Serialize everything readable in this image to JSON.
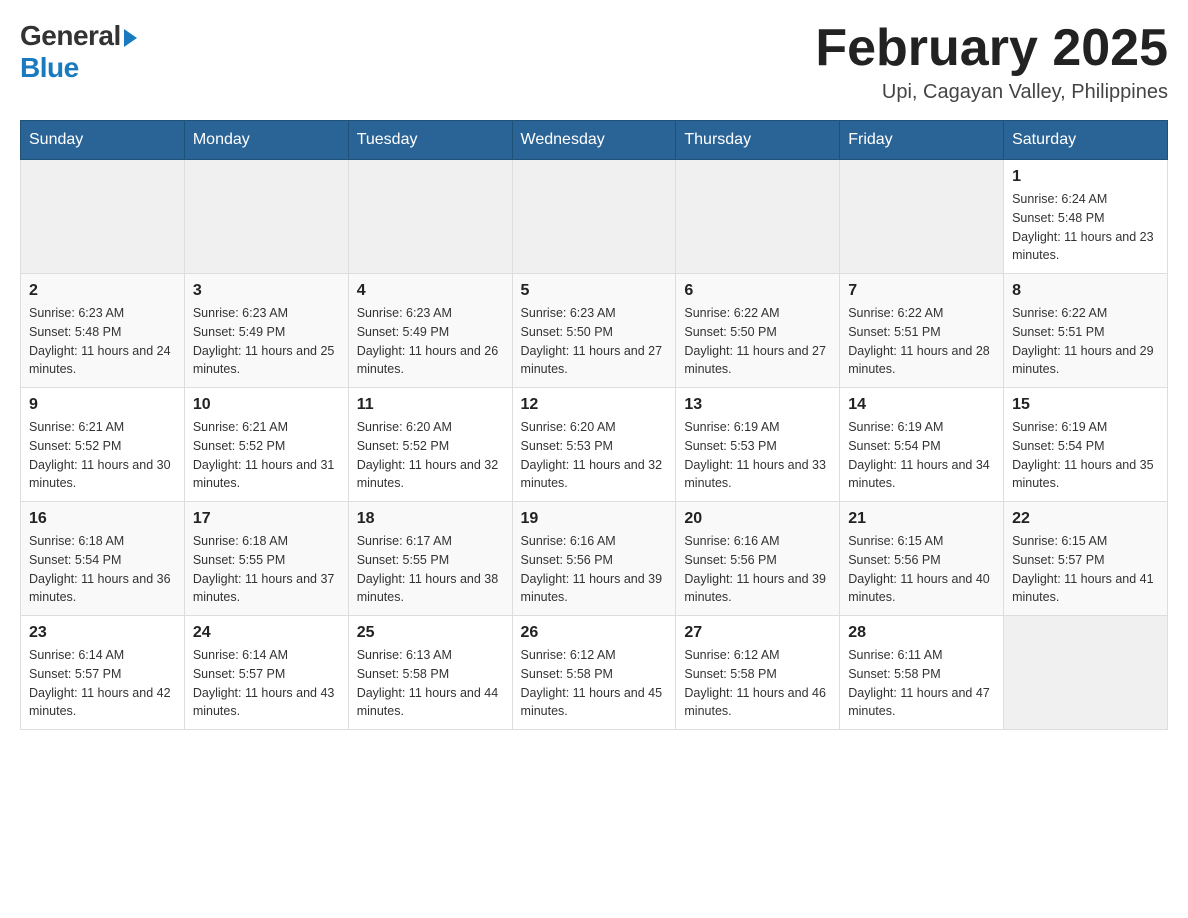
{
  "header": {
    "month_title": "February 2025",
    "location": "Upi, Cagayan Valley, Philippines",
    "logo_general": "General",
    "logo_blue": "Blue"
  },
  "weekdays": [
    "Sunday",
    "Monday",
    "Tuesday",
    "Wednesday",
    "Thursday",
    "Friday",
    "Saturday"
  ],
  "weeks": [
    [
      {
        "day": "",
        "sunrise": "",
        "sunset": "",
        "daylight": ""
      },
      {
        "day": "",
        "sunrise": "",
        "sunset": "",
        "daylight": ""
      },
      {
        "day": "",
        "sunrise": "",
        "sunset": "",
        "daylight": ""
      },
      {
        "day": "",
        "sunrise": "",
        "sunset": "",
        "daylight": ""
      },
      {
        "day": "",
        "sunrise": "",
        "sunset": "",
        "daylight": ""
      },
      {
        "day": "",
        "sunrise": "",
        "sunset": "",
        "daylight": ""
      },
      {
        "day": "1",
        "sunrise": "Sunrise: 6:24 AM",
        "sunset": "Sunset: 5:48 PM",
        "daylight": "Daylight: 11 hours and 23 minutes."
      }
    ],
    [
      {
        "day": "2",
        "sunrise": "Sunrise: 6:23 AM",
        "sunset": "Sunset: 5:48 PM",
        "daylight": "Daylight: 11 hours and 24 minutes."
      },
      {
        "day": "3",
        "sunrise": "Sunrise: 6:23 AM",
        "sunset": "Sunset: 5:49 PM",
        "daylight": "Daylight: 11 hours and 25 minutes."
      },
      {
        "day": "4",
        "sunrise": "Sunrise: 6:23 AM",
        "sunset": "Sunset: 5:49 PM",
        "daylight": "Daylight: 11 hours and 26 minutes."
      },
      {
        "day": "5",
        "sunrise": "Sunrise: 6:23 AM",
        "sunset": "Sunset: 5:50 PM",
        "daylight": "Daylight: 11 hours and 27 minutes."
      },
      {
        "day": "6",
        "sunrise": "Sunrise: 6:22 AM",
        "sunset": "Sunset: 5:50 PM",
        "daylight": "Daylight: 11 hours and 27 minutes."
      },
      {
        "day": "7",
        "sunrise": "Sunrise: 6:22 AM",
        "sunset": "Sunset: 5:51 PM",
        "daylight": "Daylight: 11 hours and 28 minutes."
      },
      {
        "day": "8",
        "sunrise": "Sunrise: 6:22 AM",
        "sunset": "Sunset: 5:51 PM",
        "daylight": "Daylight: 11 hours and 29 minutes."
      }
    ],
    [
      {
        "day": "9",
        "sunrise": "Sunrise: 6:21 AM",
        "sunset": "Sunset: 5:52 PM",
        "daylight": "Daylight: 11 hours and 30 minutes."
      },
      {
        "day": "10",
        "sunrise": "Sunrise: 6:21 AM",
        "sunset": "Sunset: 5:52 PM",
        "daylight": "Daylight: 11 hours and 31 minutes."
      },
      {
        "day": "11",
        "sunrise": "Sunrise: 6:20 AM",
        "sunset": "Sunset: 5:52 PM",
        "daylight": "Daylight: 11 hours and 32 minutes."
      },
      {
        "day": "12",
        "sunrise": "Sunrise: 6:20 AM",
        "sunset": "Sunset: 5:53 PM",
        "daylight": "Daylight: 11 hours and 32 minutes."
      },
      {
        "day": "13",
        "sunrise": "Sunrise: 6:19 AM",
        "sunset": "Sunset: 5:53 PM",
        "daylight": "Daylight: 11 hours and 33 minutes."
      },
      {
        "day": "14",
        "sunrise": "Sunrise: 6:19 AM",
        "sunset": "Sunset: 5:54 PM",
        "daylight": "Daylight: 11 hours and 34 minutes."
      },
      {
        "day": "15",
        "sunrise": "Sunrise: 6:19 AM",
        "sunset": "Sunset: 5:54 PM",
        "daylight": "Daylight: 11 hours and 35 minutes."
      }
    ],
    [
      {
        "day": "16",
        "sunrise": "Sunrise: 6:18 AM",
        "sunset": "Sunset: 5:54 PM",
        "daylight": "Daylight: 11 hours and 36 minutes."
      },
      {
        "day": "17",
        "sunrise": "Sunrise: 6:18 AM",
        "sunset": "Sunset: 5:55 PM",
        "daylight": "Daylight: 11 hours and 37 minutes."
      },
      {
        "day": "18",
        "sunrise": "Sunrise: 6:17 AM",
        "sunset": "Sunset: 5:55 PM",
        "daylight": "Daylight: 11 hours and 38 minutes."
      },
      {
        "day": "19",
        "sunrise": "Sunrise: 6:16 AM",
        "sunset": "Sunset: 5:56 PM",
        "daylight": "Daylight: 11 hours and 39 minutes."
      },
      {
        "day": "20",
        "sunrise": "Sunrise: 6:16 AM",
        "sunset": "Sunset: 5:56 PM",
        "daylight": "Daylight: 11 hours and 39 minutes."
      },
      {
        "day": "21",
        "sunrise": "Sunrise: 6:15 AM",
        "sunset": "Sunset: 5:56 PM",
        "daylight": "Daylight: 11 hours and 40 minutes."
      },
      {
        "day": "22",
        "sunrise": "Sunrise: 6:15 AM",
        "sunset": "Sunset: 5:57 PM",
        "daylight": "Daylight: 11 hours and 41 minutes."
      }
    ],
    [
      {
        "day": "23",
        "sunrise": "Sunrise: 6:14 AM",
        "sunset": "Sunset: 5:57 PM",
        "daylight": "Daylight: 11 hours and 42 minutes."
      },
      {
        "day": "24",
        "sunrise": "Sunrise: 6:14 AM",
        "sunset": "Sunset: 5:57 PM",
        "daylight": "Daylight: 11 hours and 43 minutes."
      },
      {
        "day": "25",
        "sunrise": "Sunrise: 6:13 AM",
        "sunset": "Sunset: 5:58 PM",
        "daylight": "Daylight: 11 hours and 44 minutes."
      },
      {
        "day": "26",
        "sunrise": "Sunrise: 6:12 AM",
        "sunset": "Sunset: 5:58 PM",
        "daylight": "Daylight: 11 hours and 45 minutes."
      },
      {
        "day": "27",
        "sunrise": "Sunrise: 6:12 AM",
        "sunset": "Sunset: 5:58 PM",
        "daylight": "Daylight: 11 hours and 46 minutes."
      },
      {
        "day": "28",
        "sunrise": "Sunrise: 6:11 AM",
        "sunset": "Sunset: 5:58 PM",
        "daylight": "Daylight: 11 hours and 47 minutes."
      },
      {
        "day": "",
        "sunrise": "",
        "sunset": "",
        "daylight": ""
      }
    ]
  ]
}
